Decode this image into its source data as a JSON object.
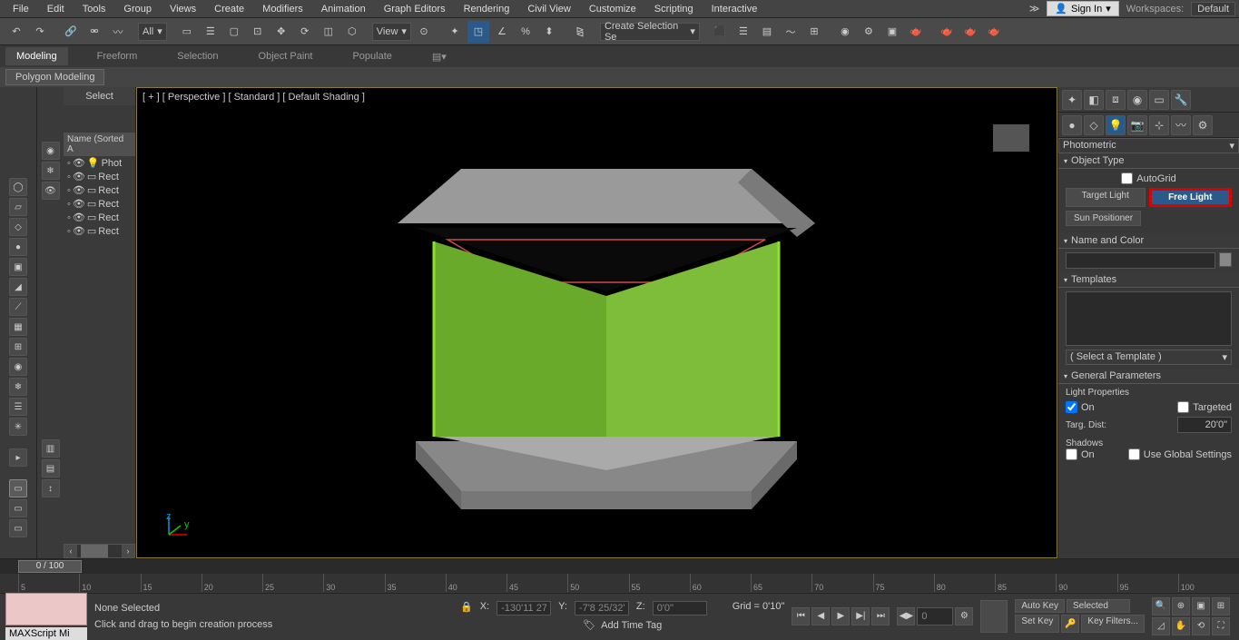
{
  "menu": {
    "file": "File",
    "edit": "Edit",
    "tools": "Tools",
    "group": "Group",
    "views": "Views",
    "create": "Create",
    "modifiers": "Modifiers",
    "animation": "Animation",
    "graph": "Graph Editors",
    "rendering": "Rendering",
    "civil": "Civil View",
    "customize": "Customize",
    "scripting": "Scripting",
    "interactive": "Interactive"
  },
  "signin": "Sign In",
  "workspaces_label": "Workspaces:",
  "workspace": "Default",
  "toolbar": {
    "all": "All",
    "view": "View",
    "selset": "Create Selection Se"
  },
  "ribbon": {
    "modeling": "Modeling",
    "freeform": "Freeform",
    "selection": "Selection",
    "objpaint": "Object Paint",
    "populate": "Populate"
  },
  "subribbon": "Polygon Modeling",
  "select_header": "Select",
  "list_header": "Name (Sorted A",
  "scene_items": [
    {
      "label": "Phot"
    },
    {
      "label": "Rect"
    },
    {
      "label": "Rect"
    },
    {
      "label": "Rect"
    },
    {
      "label": "Rect"
    },
    {
      "label": "Rect"
    }
  ],
  "viewport_label": "[ + ] [ Perspective ] [ Standard ] [ Default Shading ]",
  "right": {
    "category": "Photometric",
    "objtype_hdr": "Object Type",
    "autogrid": "AutoGrid",
    "target_light": "Target Light",
    "free_light": "Free Light",
    "sun_pos": "Sun Positioner",
    "namecolor_hdr": "Name and Color",
    "templates_hdr": "Templates",
    "select_template": "( Select a Template )",
    "genparam_hdr": "General Parameters",
    "lightprops": "Light Properties",
    "on": "On",
    "targeted": "Targeted",
    "targdist_label": "Targ. Dist:",
    "targdist_val": "20'0\"",
    "shadows": "Shadows",
    "useglobal": "Use Global Settings"
  },
  "timeline": {
    "frame": "0 / 100",
    "ticks": [
      "5",
      "10",
      "15",
      "20",
      "25",
      "30",
      "35",
      "40",
      "45",
      "50",
      "55",
      "60",
      "65",
      "70",
      "75",
      "80",
      "85",
      "90",
      "95",
      "100"
    ]
  },
  "status": {
    "maxscript": "MAXScript Mi",
    "none_sel": "None Selected",
    "hint": "Click and drag to begin creation process",
    "x_label": "X:",
    "x": "-130'11 27",
    "y_label": "Y:",
    "y": "-7'8 25/32\"",
    "z_label": "Z:",
    "z": "0'0\"",
    "grid": "Grid = 0'10\"",
    "addtime": "Add Time Tag",
    "frame": "0",
    "autokey": "Auto Key",
    "setkey": "Set Key",
    "selected": "Selected",
    "keyfilters": "Key Filters..."
  }
}
